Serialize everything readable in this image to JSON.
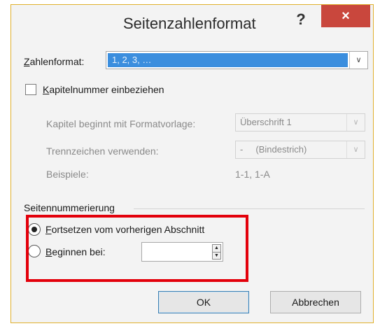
{
  "dialog": {
    "title": "Seitenzahlenformat",
    "help_label": "?",
    "close_label": "×"
  },
  "number_format": {
    "label_first": "Z",
    "label_rest": "ahlenformat:",
    "value": "1, 2, 3, …"
  },
  "chapter": {
    "checkbox_label_first": "K",
    "checkbox_label_rest": "apitelnummer einbeziehen",
    "checked": false,
    "style_label": "Kapitel beginnt mit Formatvorlage:",
    "style_value": "Überschrift 1",
    "separator_label": "Trennzeichen verwenden:",
    "separator_value": "-     (Bindestrich)",
    "examples_label": "Beispiele:",
    "examples_value": "1-1, 1-A"
  },
  "page_numbering": {
    "group_label": "Seitennummerierung",
    "continue_first": "F",
    "continue_rest": "ortsetzen vom vorherigen Abschnitt",
    "start_first": "B",
    "start_rest": "eginnen bei:",
    "start_value": "",
    "selected": "continue"
  },
  "buttons": {
    "ok": "OK",
    "cancel": "Abbrechen"
  },
  "colors": {
    "highlight": "#e3000b",
    "close_button": "#c9473d",
    "selection": "#3b8ede"
  }
}
